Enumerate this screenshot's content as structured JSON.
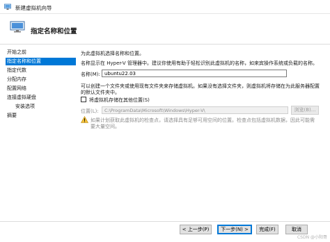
{
  "window": {
    "title": "新建虚拟机向导"
  },
  "header": {
    "heading": "指定名称和位置"
  },
  "sidebar": {
    "items": [
      {
        "label": "开始之前"
      },
      {
        "label": "指定名称和位置"
      },
      {
        "label": "指定代数"
      },
      {
        "label": "分配内存"
      },
      {
        "label": "配置网络"
      },
      {
        "label": "连接虚拟硬盘"
      },
      {
        "label": "安装选项"
      },
      {
        "label": "摘要"
      }
    ]
  },
  "main": {
    "intro": "为此虚拟机选择名称和位置。",
    "description": "名称显示在 Hyper-V 管理器中。建议你使用有助于轻松识别此虚拟机的名称，如来宾操作系统或负载的名称。",
    "name_label": "名称(M):",
    "name_value": "ubuntu22.03",
    "folder_info_line1": "可以创建一个文件夹或使用现有文件夹来存储虚拟机。如果没有选择文件夹，则虚拟机将存储在为此服务器配置",
    "folder_info_line2": "的默认文件夹中。",
    "store_checkbox_label": "将虚拟机存储在其他位置(S)",
    "store_checkbox_checked": false,
    "location_label": "位置(L):",
    "location_value": "C:\\ProgramData\\Microsoft\\Windows\\Hyper-V\\",
    "browse_label": "浏览(B)...",
    "warning_line1": "如果计划获取此虚拟机的检查点，请选择具有足够可用空间的位置。检查点包括虚拟机数据，因此可能需",
    "warning_line2": "要大量空间。"
  },
  "footer": {
    "prev_label": "< 上一步(P)",
    "next_label": "下一步(N) >",
    "finish_label": "完成(F)",
    "cancel_label": "取消",
    "watermark": "CSDN @小阳哥"
  },
  "colors": {
    "accent": "#0078d7",
    "warning": "#e8a317"
  },
  "icons": {
    "app": "hyperv-app-icon",
    "wizard": "monitor-wizard-icon",
    "warning": "warning-triangle-icon"
  }
}
